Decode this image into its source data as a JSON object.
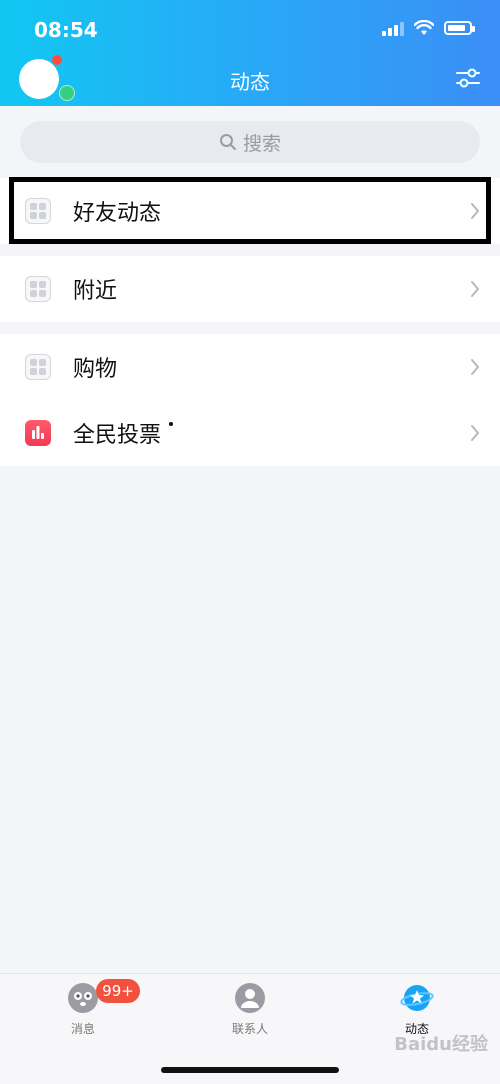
{
  "status_bar": {
    "time": "08:54"
  },
  "header": {
    "title": "动态"
  },
  "search": {
    "placeholder": "搜索"
  },
  "groups": [
    {
      "items": [
        {
          "label": "好友动态"
        }
      ]
    },
    {
      "items": [
        {
          "label": "附近"
        }
      ]
    },
    {
      "items": [
        {
          "label": "购物"
        },
        {
          "label": "全民投票"
        }
      ]
    }
  ],
  "tabbar": {
    "tabs": [
      {
        "label": "消息",
        "badge": "99+"
      },
      {
        "label": "联系人"
      },
      {
        "label": "动态",
        "active": true
      }
    ]
  },
  "watermark": "Baidu经验",
  "colors": {
    "header_start": "#12c7f2",
    "header_end": "#3b8ef6",
    "badge": "#f2523d",
    "vote_icon": "#f23a55"
  }
}
